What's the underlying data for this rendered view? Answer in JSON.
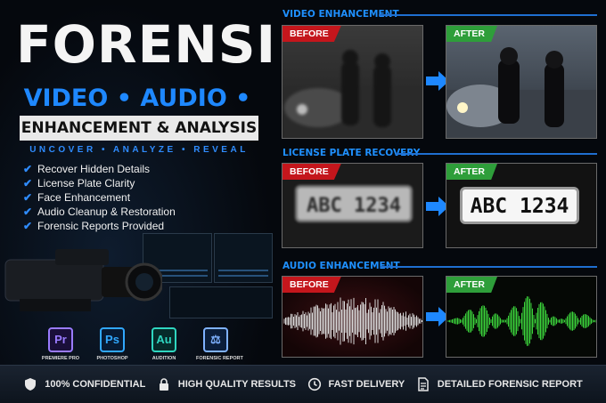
{
  "hero": {
    "title": "FORENSIC",
    "subtitle": "VIDEO • AUDIO • IMAGE",
    "banner": "ENHANCEMENT & ANALYSIS",
    "tagline": "UNCOVER • ANALYZE • REVEAL"
  },
  "features": [
    "Recover Hidden Details",
    "License Plate Clarity",
    "Face Enhancement",
    "Audio Cleanup & Restoration",
    "Forensic Reports Provided"
  ],
  "apps": [
    {
      "abbr": "Pr",
      "label": "PREMIERE PRO",
      "color": "#9a7bff",
      "icon": "premiere-pro-icon"
    },
    {
      "abbr": "Ps",
      "label": "PHOTOSHOP",
      "color": "#31a8ff",
      "icon": "photoshop-icon"
    },
    {
      "abbr": "Au",
      "label": "AUDITION",
      "color": "#2fd6c0",
      "icon": "audition-icon"
    },
    {
      "abbr": "⚖",
      "label": "FORENSIC REPORT",
      "color": "#7fb2ff",
      "icon": "scales-icon"
    }
  ],
  "sections": {
    "video": {
      "title": "VIDEO ENHANCEMENT",
      "before": "BEFORE",
      "after": "AFTER"
    },
    "plate": {
      "title": "LICENSE PLATE RECOVERY",
      "before": "BEFORE",
      "after": "AFTER",
      "plate_text": "ABC 1234"
    },
    "audio": {
      "title": "AUDIO ENHANCEMENT",
      "before": "BEFORE",
      "after": "AFTER"
    }
  },
  "badges": [
    {
      "label": "100% CONFIDENTIAL",
      "icon": "shield-icon"
    },
    {
      "label": "HIGH QUALITY RESULTS",
      "icon": "lock-icon"
    },
    {
      "label": "FAST DELIVERY",
      "icon": "clock-icon"
    },
    {
      "label": "DETAILED FORENSIC REPORT",
      "icon": "document-icon"
    }
  ],
  "colors": {
    "accent": "#1f90ff",
    "before": "#c4161c",
    "after": "#2e9e3a",
    "waveform_after": "#3ad13a"
  }
}
